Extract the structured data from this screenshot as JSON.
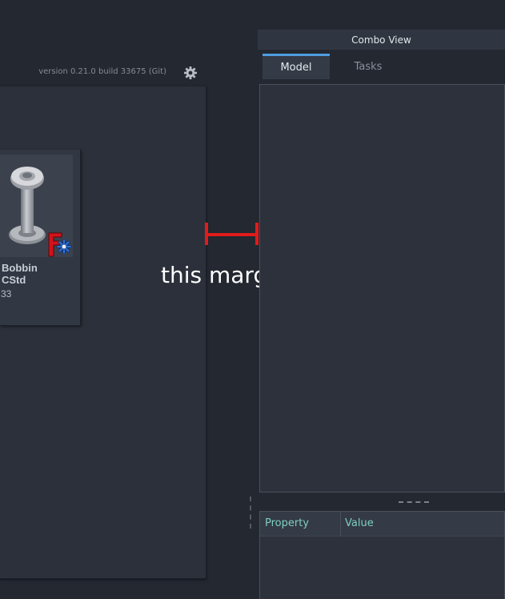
{
  "start_page": {
    "version_text": "version 0.21.0 build 33675 (Git)",
    "settings_icon": "gear-icon",
    "recent_file": {
      "title": "Bobbin\nCStd",
      "size": "33"
    }
  },
  "annotation": {
    "text": "this margin",
    "color": "#e11b1b"
  },
  "combo_view": {
    "title": "Combo View",
    "tabs": [
      {
        "label": "Model",
        "active": true
      },
      {
        "label": "Tasks",
        "active": false
      }
    ],
    "property_table": {
      "columns": [
        "Property",
        "Value"
      ]
    }
  },
  "colors": {
    "background": "#232831",
    "panel": "#2b303a",
    "accent": "#4d9de0",
    "header_text": "#7ecfc0"
  }
}
